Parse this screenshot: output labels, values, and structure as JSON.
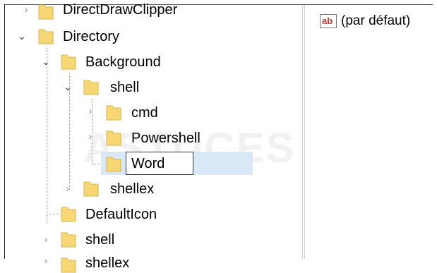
{
  "tree": {
    "items": [
      {
        "label": "DirectDrawClipper",
        "expanded": false
      },
      {
        "label": "Directory",
        "expanded": true
      },
      {
        "label": "Background",
        "expanded": true
      },
      {
        "label": "shell",
        "expanded": true
      },
      {
        "label": "cmd",
        "expanded": false
      },
      {
        "label": "Powershell",
        "expanded": false
      },
      {
        "label": "Word",
        "editing": true
      },
      {
        "label": "shellex",
        "expanded": false
      },
      {
        "label": "DefaultIcon"
      },
      {
        "label": "shell",
        "expanded": false
      },
      {
        "label": "shellex",
        "expanded": false
      }
    ]
  },
  "values_pane": {
    "icon": "ab-string-value-icon",
    "icon_text": "ab",
    "default_label": "(par défaut)"
  },
  "watermark": "ASTUCES",
  "colors": {
    "selection": "#d9e8f7",
    "folder": "#f7d774",
    "icon_red": "#c0392b"
  }
}
